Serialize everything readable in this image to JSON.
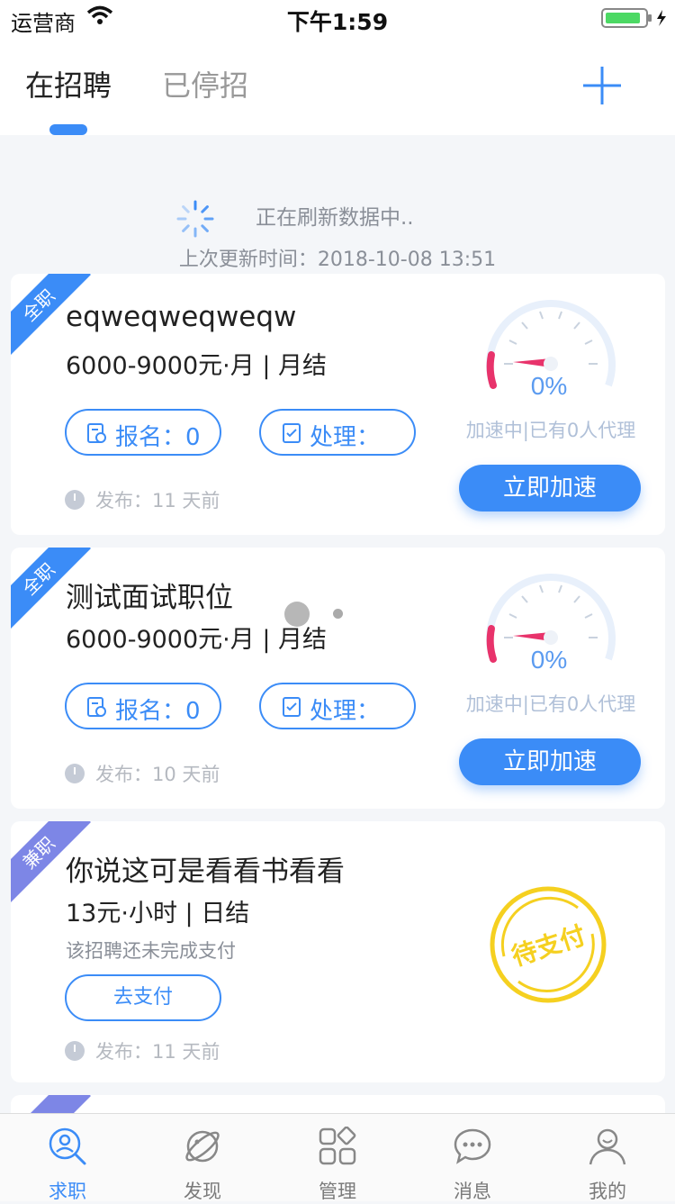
{
  "status_bar": {
    "carrier": "运营商",
    "time": "下午1:59"
  },
  "header": {
    "tabs": [
      {
        "label": "在招聘"
      },
      {
        "label": "已停招"
      }
    ]
  },
  "refresh": {
    "text": "正在刷新数据中..",
    "last_update": "上次更新时间：2018-10-08 13:51"
  },
  "jobs": [
    {
      "type_badge": "全职",
      "title": "eqweqweqweqw",
      "salary": "6000-9000元·月 | 月结",
      "signup": "报名：0",
      "process": "处理：",
      "posted": "发布：11 天前",
      "speed_percent": "0%",
      "speed_text": "加速中|已有0人代理",
      "speed_button": "立即加速"
    },
    {
      "type_badge": "全职",
      "title": "测试面试职位",
      "salary": "6000-9000元·月 | 月结",
      "signup": "报名：0",
      "process": "处理：",
      "posted": "发布：10 天前",
      "speed_percent": "0%",
      "speed_text": "加速中|已有0人代理",
      "speed_button": "立即加速"
    },
    {
      "type_badge": "兼职",
      "title": "你说这可是看看书看看",
      "salary": "13元·小时 | 日结",
      "pay_status": "该招聘还未完成支付",
      "pay_button": "去支付",
      "posted": "发布：11 天前",
      "stamp": "待支付"
    }
  ],
  "tabbar": {
    "items": [
      {
        "label": "求职",
        "icon": "job-search-icon"
      },
      {
        "label": "发现",
        "icon": "planet-icon"
      },
      {
        "label": "管理",
        "icon": "grid-icon"
      },
      {
        "label": "消息",
        "icon": "chat-icon"
      },
      {
        "label": "我的",
        "icon": "user-icon"
      }
    ]
  },
  "colors": {
    "accent": "#3b8cf7",
    "stamp": "#f5d020",
    "gauge_needle": "#e8336b"
  }
}
